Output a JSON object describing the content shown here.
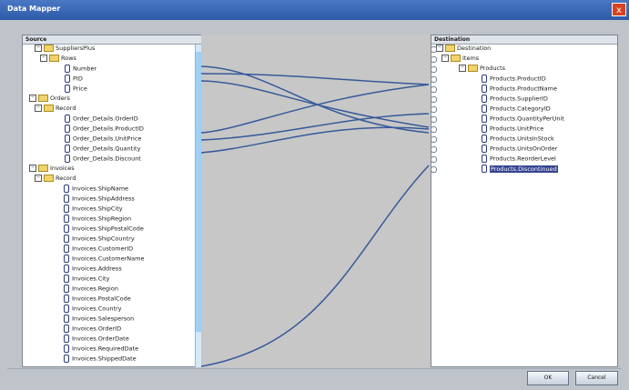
{
  "window": {
    "title": "Data Mapper",
    "close_symbol": "x"
  },
  "source": {
    "header": "Source",
    "items": [
      {
        "label": "SuppliersPlus",
        "kind": "folder",
        "expander": "−"
      },
      {
        "label": "Rows",
        "kind": "folder",
        "expander": "−"
      },
      {
        "label": "Number",
        "kind": "leaf"
      },
      {
        "label": "PID",
        "kind": "leaf"
      },
      {
        "label": "Price",
        "kind": "leaf"
      },
      {
        "label": "Orders",
        "kind": "folder",
        "expander": "−"
      },
      {
        "label": "Record",
        "kind": "folder",
        "expander": "−"
      },
      {
        "label": "Order_Details.OrderID",
        "kind": "leaf"
      },
      {
        "label": "Order_Details.ProductID",
        "kind": "leaf"
      },
      {
        "label": "Order_Details.UnitPrice",
        "kind": "leaf"
      },
      {
        "label": "Order_Details.Quantity",
        "kind": "leaf"
      },
      {
        "label": "Order_Details.Discount",
        "kind": "leaf"
      },
      {
        "label": "Invoices",
        "kind": "folder",
        "expander": "−"
      },
      {
        "label": "Record",
        "kind": "folder",
        "expander": "−"
      },
      {
        "label": "Invoices.ShipName",
        "kind": "leaf"
      },
      {
        "label": "Invoices.ShipAddress",
        "kind": "leaf"
      },
      {
        "label": "Invoices.ShipCity",
        "kind": "leaf"
      },
      {
        "label": "Invoices.ShipRegion",
        "kind": "leaf"
      },
      {
        "label": "Invoices.ShipPostalCode",
        "kind": "leaf"
      },
      {
        "label": "Invoices.ShipCountry",
        "kind": "leaf"
      },
      {
        "label": "Invoices.CustomerID",
        "kind": "leaf"
      },
      {
        "label": "Invoices.CustomerName",
        "kind": "leaf"
      },
      {
        "label": "Invoices.Address",
        "kind": "leaf"
      },
      {
        "label": "Invoices.City",
        "kind": "leaf"
      },
      {
        "label": "Invoices.Region",
        "kind": "leaf"
      },
      {
        "label": "Invoices.PostalCode",
        "kind": "leaf"
      },
      {
        "label": "Invoices.Country",
        "kind": "leaf"
      },
      {
        "label": "Invoices.Salesperson",
        "kind": "leaf"
      },
      {
        "label": "Invoices.OrderID",
        "kind": "leaf"
      },
      {
        "label": "Invoices.OrderDate",
        "kind": "leaf"
      },
      {
        "label": "Invoices.RequiredDate",
        "kind": "leaf"
      },
      {
        "label": "Invoices.ShippedDate",
        "kind": "leaf"
      }
    ]
  },
  "destination": {
    "header": "Destination",
    "items": [
      {
        "label": "Destination",
        "kind": "folder",
        "expander": "−"
      },
      {
        "label": "Items",
        "kind": "folder",
        "expander": "−"
      },
      {
        "label": "Products",
        "kind": "folder",
        "expander": "−"
      },
      {
        "label": "Products.ProductID",
        "kind": "leaf"
      },
      {
        "label": "Products.ProductName",
        "kind": "leaf"
      },
      {
        "label": "Products.SupplierID",
        "kind": "leaf"
      },
      {
        "label": "Products.CategoryID",
        "kind": "leaf"
      },
      {
        "label": "Products.QuantityPerUnit",
        "kind": "leaf"
      },
      {
        "label": "Products.UnitPrice",
        "kind": "leaf"
      },
      {
        "label": "Products.UnitsInStock",
        "kind": "leaf"
      },
      {
        "label": "Products.UnitsOnOrder",
        "kind": "leaf"
      },
      {
        "label": "Products.ReorderLevel",
        "kind": "leaf"
      },
      {
        "label": "Products.Discontinued",
        "kind": "leaf",
        "selected": true
      }
    ]
  },
  "buttons": {
    "ok": "OK",
    "cancel": "Cancel"
  },
  "colors": {
    "title": "#2d5aa8",
    "link": "#365a9a",
    "selected": "#33438f"
  }
}
